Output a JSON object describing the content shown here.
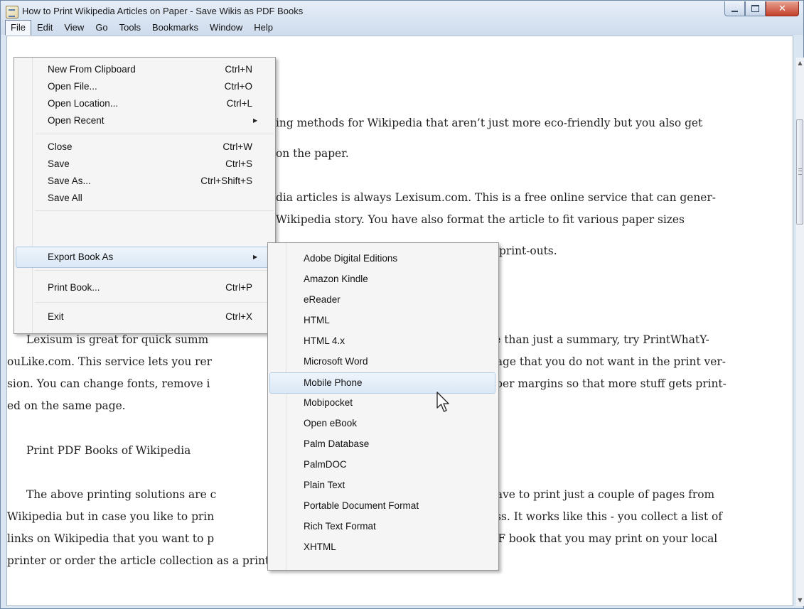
{
  "window": {
    "title": "How to Print Wikipedia Articles on Paper - Save Wikis as PDF Books",
    "app_icon": "document-icon",
    "controls": {
      "minimize": "minimize-icon",
      "maximize": "maximize-icon",
      "close_glyph": "✕"
    }
  },
  "menubar": [
    "File",
    "Edit",
    "View",
    "Go",
    "Tools",
    "Bookmarks",
    "Window",
    "Help"
  ],
  "article": {
    "lines": [
      "ing methods for Wikipedia that aren’t just more eco-friendly but you also get",
      "on the paper.",
      "dia articles is always Lexisum.com. This is a free online service that can gener-",
      "Wikipedia story. You have also format the article to fit various paper sizes",
      "e print-outs.",
      "Lexisum is great for quick summ",
      "re than just a summary, try PrintWhatY-",
      "ouLike.com. This service lets you rer",
      "page that you do not want in the print ver-",
      "sion. You can change fonts, remove i",
      "aper margins so that more stuff gets print-",
      "ed on the same page.",
      "Print PDF Books of Wikipedia",
      "The above printing solutions are c",
      "have to print just a couple of pages from",
      "Wikipedia but in case you like to prin",
      "ess. It works like this - you collect a list of",
      "links on Wikipedia that you want to p",
      "DF book that you may print on your local",
      "printer or order the article collection as a printed book."
    ]
  },
  "file_menu": {
    "items": [
      {
        "label": "New From Clipboard",
        "shortcut": "Ctrl+N"
      },
      {
        "label": "Open File...",
        "shortcut": "Ctrl+O"
      },
      {
        "label": "Open Location...",
        "shortcut": "Ctrl+L"
      },
      {
        "label": "Open Recent",
        "shortcut": ""
      },
      {
        "label": "Close",
        "shortcut": "Ctrl+W"
      },
      {
        "label": "Save",
        "shortcut": "Ctrl+S"
      },
      {
        "label": "Save As...",
        "shortcut": "Ctrl+Shift+S"
      },
      {
        "label": "Save All",
        "shortcut": ""
      },
      {
        "label": "Export Book As",
        "shortcut": ""
      },
      {
        "label": "Print Book...",
        "shortcut": "Ctrl+P"
      },
      {
        "label": "Exit",
        "shortcut": "Ctrl+X"
      }
    ],
    "submenu_arrow": "▶"
  },
  "export_submenu": {
    "items": [
      "Adobe Digital Editions",
      "Amazon Kindle",
      "eReader",
      "HTML",
      "HTML 4.x",
      "Microsoft Word",
      "Mobile Phone",
      "Mobipocket",
      "Open eBook",
      "Palm Database",
      "PalmDOC",
      "Plain Text",
      "Portable Document Format",
      "Rich Text Format",
      "XHTML"
    ],
    "highlighted": "Mobile Phone"
  },
  "scrollbar": {
    "up_arrow": "▲",
    "down_arrow": "▼",
    "position": 0.12
  }
}
